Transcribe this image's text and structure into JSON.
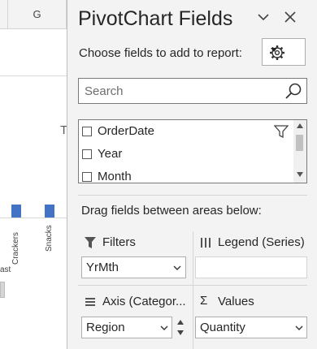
{
  "sheet": {
    "column_header": "G",
    "chart_title_fragment": "T",
    "categories": [
      "Crackers",
      "Snacks"
    ],
    "category_fragment": "ast",
    "bar_color": "#4472c4"
  },
  "pane": {
    "title": "PivotChart Fields",
    "choose_label": "Choose fields to add to report:",
    "search_placeholder": "Search",
    "fields": [
      {
        "label": "OrderDate",
        "checked": false
      },
      {
        "label": "Year",
        "checked": false
      },
      {
        "label": "Month",
        "checked": false
      }
    ],
    "drag_label": "Drag fields between areas below:",
    "areas": {
      "filters": {
        "header": "Filters",
        "icon": "filter-icon",
        "items": [
          "YrMth"
        ]
      },
      "legend": {
        "header": "Legend (Series)",
        "icon": "columns-icon",
        "items": []
      },
      "axis": {
        "header": "Axis (Categor...",
        "icon": "rows-icon",
        "items": [
          "Region"
        ]
      },
      "values": {
        "header": "Values",
        "icon": "sigma-icon",
        "items": [
          "Quantity"
        ]
      }
    }
  }
}
